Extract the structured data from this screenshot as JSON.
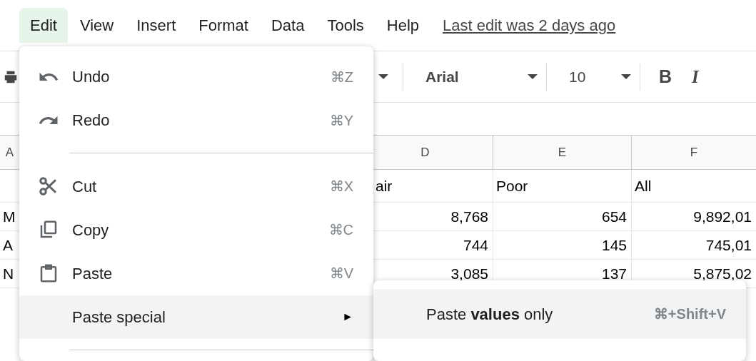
{
  "menubar": {
    "items": [
      {
        "label": "Edit",
        "selected": true
      },
      {
        "label": "View",
        "selected": false
      },
      {
        "label": "Insert",
        "selected": false
      },
      {
        "label": "Format",
        "selected": false
      },
      {
        "label": "Data",
        "selected": false
      },
      {
        "label": "Tools",
        "selected": false
      },
      {
        "label": "Help",
        "selected": false
      }
    ],
    "last_edit": "Last edit was 2 days ago"
  },
  "toolbar": {
    "font": "Arial",
    "font_size": "10",
    "format_buttons": [
      {
        "kind": "bold",
        "label": "B"
      },
      {
        "kind": "italic",
        "label": "I"
      }
    ]
  },
  "sheet": {
    "columns": [
      "A",
      null,
      "D",
      "E",
      "F"
    ],
    "rows": [
      [
        null,
        null,
        "air",
        "Poor",
        "All"
      ],
      [
        "M",
        null,
        "8,768",
        "654",
        "9,892,01"
      ],
      [
        "A",
        null,
        "744",
        "145",
        "745,01"
      ],
      [
        "N",
        null,
        "3,085",
        "137",
        "5,875,02"
      ]
    ]
  },
  "edit_menu": {
    "items": [
      {
        "kind": "command",
        "label": "Undo",
        "shortcut": "⌘Z",
        "selected": false
      },
      {
        "kind": "command",
        "label": "Redo",
        "shortcut": "⌘Y",
        "selected": false
      },
      {
        "kind": "divider"
      },
      {
        "kind": "command",
        "label": "Cut",
        "shortcut": "⌘X",
        "selected": false
      },
      {
        "kind": "command",
        "label": "Copy",
        "shortcut": "⌘C",
        "selected": false
      },
      {
        "kind": "command",
        "label": "Paste",
        "shortcut": "⌘V",
        "selected": false
      },
      {
        "kind": "submenu",
        "label": "Paste special",
        "arrow": "►",
        "selected": true
      },
      {
        "kind": "divider"
      }
    ]
  },
  "submenu": {
    "items": [
      {
        "label": "Paste **values** only",
        "shortcut": "⌘+Shift+V",
        "selected": true
      }
    ]
  }
}
